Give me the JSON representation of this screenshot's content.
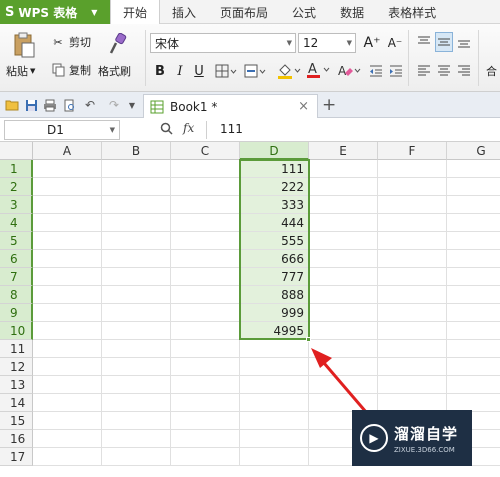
{
  "app": {
    "name": "WPS 表格",
    "logo": "S"
  },
  "menu": {
    "tabs": [
      "开始",
      "插入",
      "页面布局",
      "公式",
      "数据",
      "表格样式"
    ]
  },
  "ribbon": {
    "paste": "粘贴",
    "cut": "剪切",
    "copy": "复制",
    "format_painter": "格式刷",
    "font_name": "宋体",
    "font_size": "12",
    "bold": "B",
    "italic": "I",
    "underline": "U",
    "increase_font": "A⁺",
    "decrease_font": "A⁻",
    "merge_partial": "合"
  },
  "document": {
    "tab_title": "Book1 *"
  },
  "formula_bar": {
    "name_box": "D1",
    "fx_label": "fx",
    "content": "111"
  },
  "sheet": {
    "columns": [
      "A",
      "B",
      "C",
      "D",
      "E",
      "F",
      "G"
    ],
    "selected_column": "D",
    "rows": [
      "1",
      "2",
      "3",
      "4",
      "5",
      "6",
      "7",
      "8",
      "9",
      "10",
      "11",
      "12",
      "13",
      "14",
      "15",
      "16",
      "17"
    ],
    "column_d_values": [
      "111",
      "222",
      "333",
      "444",
      "555",
      "666",
      "777",
      "888",
      "999",
      "4995"
    ]
  },
  "watermark": {
    "title": "溜溜自学",
    "subtitle": "ZIXUE.3D66.COM"
  },
  "colors": {
    "accent": "#5aa02c",
    "selection_border": "#5b9b3a",
    "selection_fill": "#e3f1dc",
    "arrow": "#e02020"
  }
}
